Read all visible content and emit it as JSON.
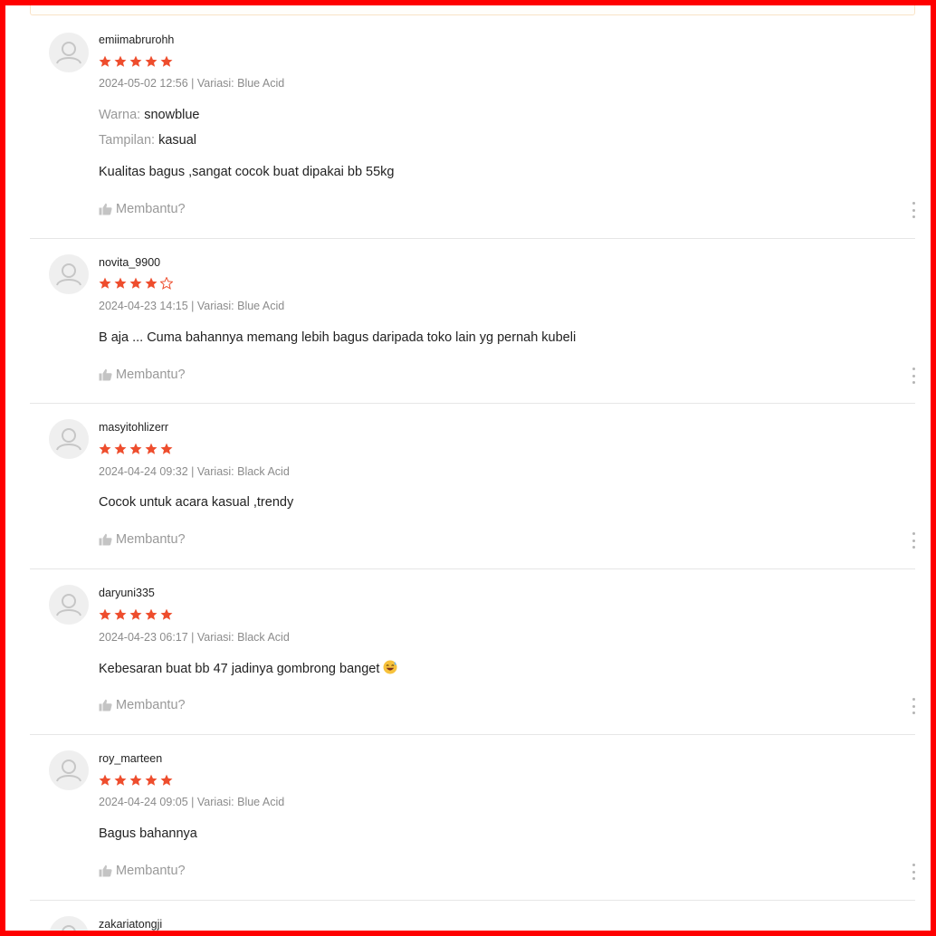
{
  "accent_color": "#ee4d2d",
  "helpful_label": "Membantu?",
  "reviews": [
    {
      "username": "emiimabrurohh",
      "rating": 5,
      "date": "2024-05-02 12:56",
      "variation": "Variasi: Blue Acid",
      "meta": "2024-05-02 12:56 | Variasi: Blue Acid",
      "attributes": [
        {
          "label": "Warna:",
          "value": "snowblue"
        },
        {
          "label": "Tampilan:",
          "value": "kasual"
        }
      ],
      "comment": "Kualitas bagus ,sangat cocok buat dipakai bb 55kg"
    },
    {
      "username": "novita_9900",
      "rating": 4,
      "date": "2024-04-23 14:15",
      "variation": "Variasi: Blue Acid",
      "meta": "2024-04-23 14:15 | Variasi: Blue Acid",
      "attributes": [],
      "comment": "B aja ... Cuma bahannya memang lebih bagus daripada toko lain yg pernah kubeli"
    },
    {
      "username": "masyitohlizerr",
      "rating": 5,
      "date": "2024-04-24 09:32",
      "variation": "Variasi: Black Acid",
      "meta": "2024-04-24 09:32 | Variasi: Black Acid",
      "attributes": [],
      "comment": "Cocok untuk acara kasual ,trendy"
    },
    {
      "username": "daryuni335",
      "rating": 5,
      "date": "2024-04-23 06:17",
      "variation": "Variasi: Black Acid",
      "meta": "2024-04-23 06:17 | Variasi: Black Acid",
      "attributes": [],
      "comment": "Kebesaran buat bb 47 jadinya gombrong banget",
      "emoji": "grinning-sweat-face-icon"
    },
    {
      "username": "roy_marteen",
      "rating": 5,
      "date": "2024-04-24 09:05",
      "variation": "Variasi: Blue Acid",
      "meta": "2024-04-24 09:05 | Variasi: Blue Acid",
      "attributes": [],
      "comment": "Bagus bahannya"
    },
    {
      "username": "zakariatongji",
      "partial": true
    }
  ]
}
